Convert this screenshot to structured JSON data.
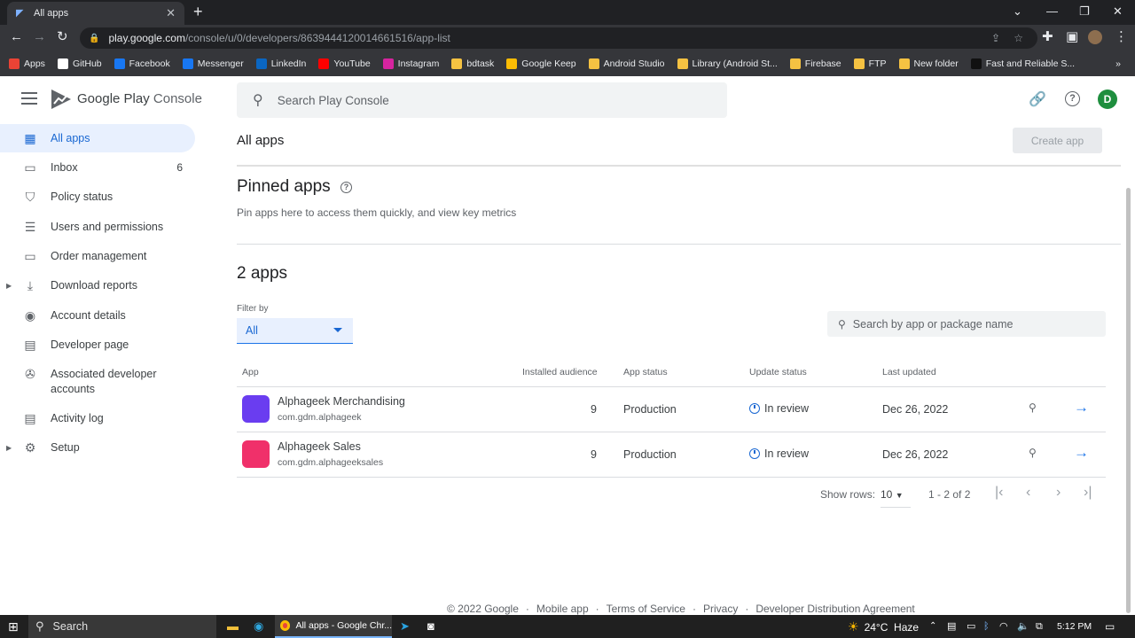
{
  "browser": {
    "tab_title": "All apps",
    "url_host": "play.google.com",
    "url_path": "/console/u/0/developers/8639444120014661516/app-list",
    "bookmarks": [
      {
        "label": "Apps",
        "icon": "apps-grid-icon",
        "color": "#ea4335"
      },
      {
        "label": "GitHub",
        "icon": "github-icon",
        "color": "#ffffff"
      },
      {
        "label": "Facebook",
        "icon": "facebook-icon",
        "color": "#1877f2"
      },
      {
        "label": "Messenger",
        "icon": "messenger-icon",
        "color": "#1877f2"
      },
      {
        "label": "LinkedIn",
        "icon": "linkedin-icon",
        "color": "#0a66c2"
      },
      {
        "label": "YouTube",
        "icon": "youtube-icon",
        "color": "#ff0000"
      },
      {
        "label": "Instagram",
        "icon": "instagram-icon",
        "color": "#d6249f"
      },
      {
        "label": "bdtask",
        "icon": "folder-icon",
        "color": "#f5c242"
      },
      {
        "label": "Google Keep",
        "icon": "keep-icon",
        "color": "#fbbc04"
      },
      {
        "label": "Android Studio",
        "icon": "folder-icon",
        "color": "#f5c242"
      },
      {
        "label": "Library (Android St...",
        "icon": "folder-icon",
        "color": "#f5c242"
      },
      {
        "label": "Firebase",
        "icon": "folder-icon",
        "color": "#f5c242"
      },
      {
        "label": "FTP",
        "icon": "folder-icon",
        "color": "#f5c242"
      },
      {
        "label": "New folder",
        "icon": "folder-icon",
        "color": "#f5c242"
      },
      {
        "label": "Fast and Reliable S...",
        "icon": "s-icon",
        "color": "#111111"
      }
    ],
    "more_bookmarks": "»"
  },
  "console": {
    "brand_prefix": "Google Play",
    "brand_suffix": "Console",
    "search_placeholder": "Search Play Console",
    "avatar_letter": "D"
  },
  "sidebar": {
    "items": [
      {
        "label": "All apps",
        "icon": "grid-icon",
        "active": true
      },
      {
        "label": "Inbox",
        "icon": "inbox-icon",
        "count": "6"
      },
      {
        "label": "Policy status",
        "icon": "shield-icon"
      },
      {
        "label": "Users and permissions",
        "icon": "users-icon"
      },
      {
        "label": "Order management",
        "icon": "card-icon"
      },
      {
        "label": "Download reports",
        "icon": "download-icon",
        "expandable": true
      },
      {
        "label": "Account details",
        "icon": "account-icon"
      },
      {
        "label": "Developer page",
        "icon": "page-icon"
      },
      {
        "label": "Associated developer accounts",
        "icon": "associated-icon"
      },
      {
        "label": "Activity log",
        "icon": "log-icon"
      },
      {
        "label": "Setup",
        "icon": "gear-icon",
        "expandable": true
      }
    ]
  },
  "main": {
    "heading": "All apps",
    "create_label": "Create app",
    "pinned_title": "Pinned apps",
    "pinned_desc": "Pin apps here to access them quickly, and view key metrics",
    "apps_title": "2 apps",
    "filter_label": "Filter by",
    "filter_value": "All",
    "app_search_placeholder": "Search by app or package name",
    "columns": [
      "App",
      "Installed audience",
      "App status",
      "Update status",
      "Last updated"
    ],
    "rows": [
      {
        "name": "Alphageek Merchandising",
        "package": "com.gdm.alphageek",
        "audience": "9",
        "status": "Production",
        "update": "In review",
        "updated": "Dec 26, 2022",
        "icon_color": "#6a3df0"
      },
      {
        "name": "Alphageek Sales",
        "package": "com.gdm.alphageeksales",
        "audience": "9",
        "status": "Production",
        "update": "In review",
        "updated": "Dec 26, 2022",
        "icon_color": "#f0306a"
      }
    ],
    "show_rows_label": "Show rows:",
    "show_rows_value": "10",
    "range": "1 - 2 of 2"
  },
  "footer": {
    "copyright": "© 2022 Google",
    "links": [
      "Mobile app",
      "Terms of Service",
      "Privacy",
      "Developer Distribution Agreement"
    ]
  },
  "taskbar": {
    "search": "Search",
    "chrome_label": "All apps - Google Chr...",
    "temp": "24°C",
    "weather": "Haze",
    "time": "5:12 PM"
  }
}
